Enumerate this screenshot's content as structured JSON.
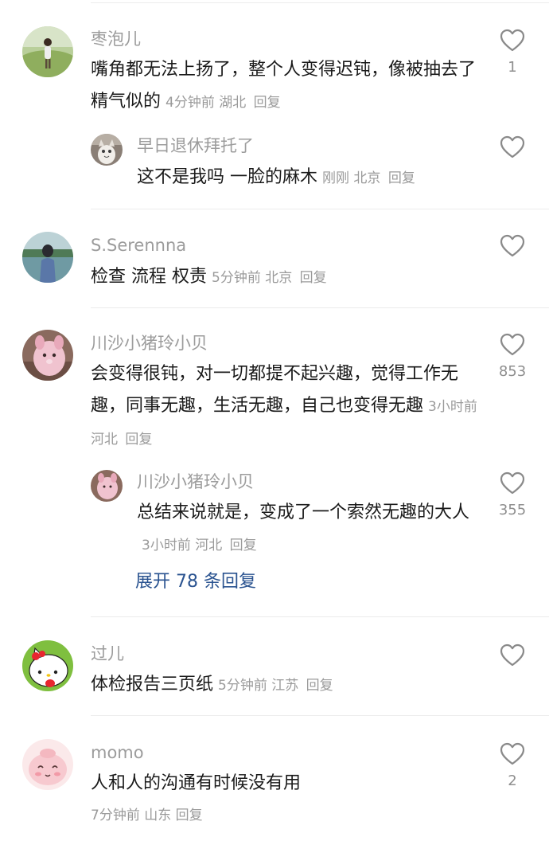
{
  "colors": {
    "username": "#9c9c9c",
    "content": "#1a1a1a",
    "meta": "#9a9a9a",
    "link": "#2a5390",
    "divider": "#ececec"
  },
  "comments": [
    {
      "username": "枣泡儿",
      "content": "嘴角都无法上扬了，整个人变得迟钝，像被抽去了精气似的",
      "time": "4分钟前",
      "location": "湖北",
      "reply": "回复",
      "likes": "1",
      "avatar": "girl-in-field-avatar",
      "replies": [
        {
          "username": "早日退休拜托了",
          "content": "这不是我吗 一脸的麻木",
          "time": "刚刚",
          "location": "北京",
          "reply": "回复",
          "likes": "",
          "avatar": "cat-avatar"
        }
      ]
    },
    {
      "username": "S.Serennna",
      "content": "检查 流程 权责",
      "time": "5分钟前",
      "location": "北京",
      "reply": "回复",
      "likes": "",
      "avatar": "girl-by-lake-avatar"
    },
    {
      "username": "川沙小猪玲小贝",
      "content": "会变得很钝，对一切都提不起兴趣，觉得工作无趣，同事无趣，生活无趣，自己也变得无趣",
      "time": "3小时前",
      "location": "河北",
      "reply": "回复",
      "likes": "853",
      "avatar": "pink-plush-avatar",
      "replies": [
        {
          "username": "川沙小猪玲小贝",
          "content": "总结来说就是，变成了一个索然无趣的大人",
          "time": "3小时前",
          "location": "河北",
          "reply": "回复",
          "likes": "355",
          "avatar": "pink-plush-avatar"
        }
      ],
      "expand_label": "展开 78 条回复"
    },
    {
      "username": "过儿",
      "content": "体检报告三页纸",
      "time": "5分钟前",
      "location": "江苏",
      "reply": "回复",
      "likes": "",
      "avatar": "hello-kitty-avatar"
    },
    {
      "username": "momo",
      "content": "人和人的沟通有时候没有用",
      "time": "7分钟前",
      "location": "山东",
      "reply": "回复",
      "likes": "2",
      "avatar": "pink-cartoon-avatar"
    }
  ]
}
